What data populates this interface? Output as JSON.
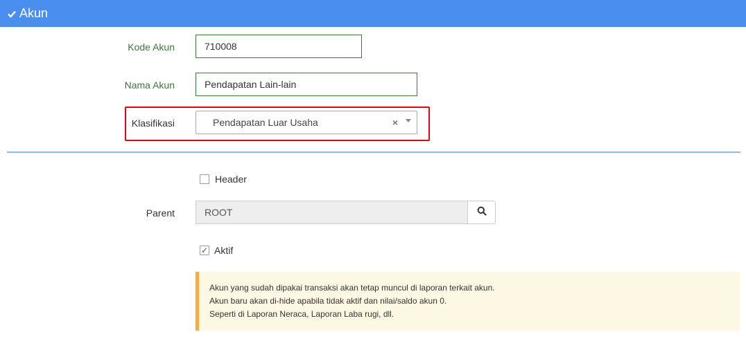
{
  "header": {
    "title": "Akun",
    "icon": "check-icon",
    "color": "#4a8ff0"
  },
  "form": {
    "kode_akun": {
      "label": "Kode Akun",
      "value": "710008"
    },
    "nama_akun": {
      "label": "Nama Akun",
      "value": "Pendapatan Lain-lain"
    },
    "klasifikasi": {
      "label": "Klasifikasi",
      "value": "Pendapatan Luar Usaha",
      "clear_symbol": "×"
    },
    "header_checkbox": {
      "label": "Header",
      "checked": false
    },
    "parent": {
      "label": "Parent",
      "value": "ROOT"
    },
    "aktif_checkbox": {
      "label": "Aktif",
      "checked": true,
      "tick": "✓"
    }
  },
  "note": {
    "lines": [
      "Akun yang sudah dipakai transaksi akan tetap muncul di laporan terkait akun.",
      "Akun baru akan di-hide apabila tidak aktif dan nilai/saldo akun 0.",
      "Seperti di Laporan Neraca, Laporan Laba rugi, dll."
    ]
  },
  "colors": {
    "highlight": "#e3000f",
    "label_green": "#3c763d",
    "note_bg": "#fcf8e3",
    "note_border": "#f0ad4e"
  }
}
